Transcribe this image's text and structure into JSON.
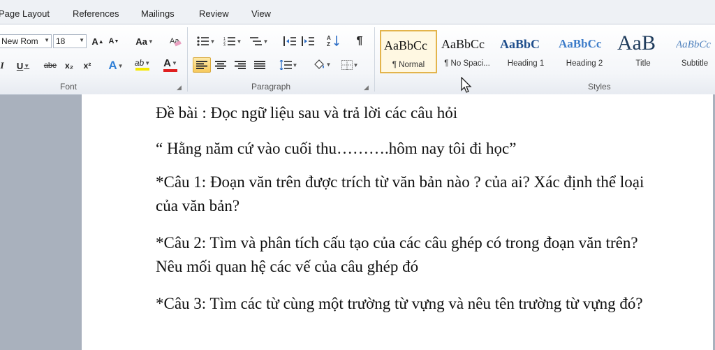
{
  "tabs": [
    "Page Layout",
    "References",
    "Mailings",
    "Review",
    "View"
  ],
  "font": {
    "name": "New Rom",
    "size": "18",
    "grow": "A",
    "shrink": "A",
    "case": "Aa",
    "clear_icon": "clear-formatting-icon",
    "italic": "I",
    "underline": "U",
    "strike": "abe",
    "subscript": "x₂",
    "superscript": "x²",
    "effects": "A",
    "highlight": "ab",
    "color": "A",
    "group_label": "Font"
  },
  "paragraph": {
    "bullets_icon": "bullets-icon",
    "numbering_icon": "numbering-icon",
    "multilevel_icon": "multilevel-list-icon",
    "decrease_indent_icon": "decrease-indent-icon",
    "increase_indent_icon": "increase-indent-icon",
    "sort_icon": "sort-icon",
    "pilcrow": "¶",
    "align_left_icon": "align-left-icon",
    "center_icon": "center-icon",
    "align_right_icon": "align-right-icon",
    "justify_icon": "justify-icon",
    "line_spacing_icon": "line-spacing-icon",
    "shading_icon": "shading-icon",
    "borders_icon": "borders-icon",
    "group_label": "Paragraph"
  },
  "styles": {
    "items": [
      {
        "sample": "AaBbCc",
        "name": "¶ Normal",
        "selected": true
      },
      {
        "sample": "AaBbCc",
        "name": "¶ No Spaci..."
      },
      {
        "sample": "AaBbC",
        "name": "Heading 1"
      },
      {
        "sample": "AaBbCc",
        "name": "Heading 2"
      },
      {
        "sample": "AaB",
        "name": "Title"
      },
      {
        "sample": "AaBbCc",
        "name": "Subtitle"
      }
    ],
    "group_label": "Styles"
  },
  "document": {
    "paragraphs": [
      "Đề bài : Đọc ngữ liệu sau và trả lời các câu hỏi",
      "“ Hằng năm cứ vào cuối thu……….hôm nay tôi đi học”",
      "*Câu 1: Đoạn văn trên được trích từ văn bản nào ? của ai? Xác định thể loại của văn bản?",
      "*Câu 2: Tìm và phân tích cấu tạo của các câu ghép có trong đoạn văn trên?Nêu mối quan hệ các vế của câu ghép đó",
      "*Câu 3: Tìm các từ cùng một  trường từ vựng và nêu tên trường từ vựng đó?"
    ]
  },
  "colors": {
    "accent_selected": "#e3b44c",
    "font_color_bar": "#e02020",
    "highlight_bar": "#f5e900"
  }
}
